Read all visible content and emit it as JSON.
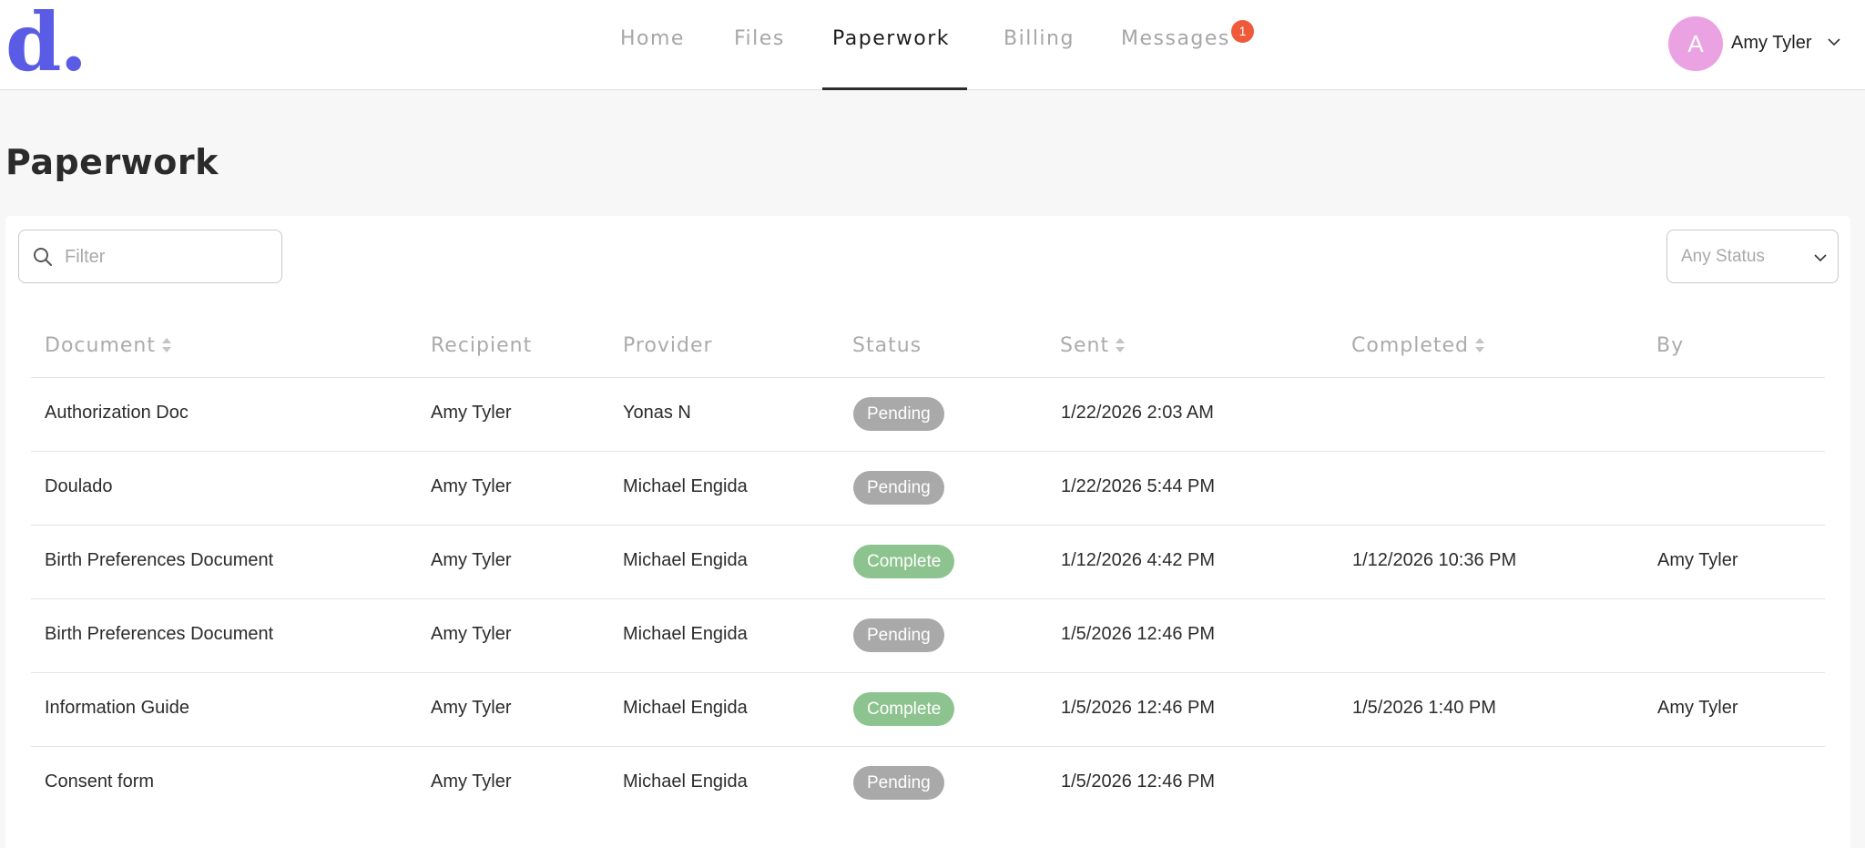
{
  "logo": {
    "text": "d."
  },
  "nav": {
    "items": [
      {
        "label": "Home"
      },
      {
        "label": "Files"
      },
      {
        "label": "Paperwork"
      },
      {
        "label": "Billing"
      },
      {
        "label": "Messages",
        "badge": "1"
      }
    ],
    "active": "Paperwork"
  },
  "user": {
    "initial": "A",
    "name": "Amy Tyler"
  },
  "page": {
    "title": "Paperwork"
  },
  "filter": {
    "placeholder": "Filter",
    "value": ""
  },
  "status_select": {
    "selected": "Any Status"
  },
  "table": {
    "headers": {
      "document": "Document",
      "recipient": "Recipient",
      "provider": "Provider",
      "status": "Status",
      "sent": "Sent",
      "completed": "Completed",
      "by": "By"
    },
    "rows": [
      {
        "document": "Authorization Doc",
        "recipient": "Amy Tyler",
        "provider": "Yonas N",
        "status": "Pending",
        "sent": "1/22/2026 2:03 AM",
        "completed": "",
        "by": ""
      },
      {
        "document": "Doulado",
        "recipient": "Amy Tyler",
        "provider": "Michael Engida",
        "status": "Pending",
        "sent": "1/22/2026 5:44 PM",
        "completed": "",
        "by": ""
      },
      {
        "document": "Birth Preferences Document",
        "recipient": "Amy Tyler",
        "provider": "Michael Engida",
        "status": "Complete",
        "sent": "1/12/2026 4:42 PM",
        "completed": "1/12/2026 10:36 PM",
        "by": "Amy Tyler"
      },
      {
        "document": "Birth Preferences Document",
        "recipient": "Amy Tyler",
        "provider": "Michael Engida",
        "status": "Pending",
        "sent": "1/5/2026 12:46 PM",
        "completed": "",
        "by": ""
      },
      {
        "document": "Information Guide",
        "recipient": "Amy Tyler",
        "provider": "Michael Engida",
        "status": "Complete",
        "sent": "1/5/2026 12:46 PM",
        "completed": "1/5/2026 1:40 PM",
        "by": "Amy Tyler"
      },
      {
        "document": "Consent form",
        "recipient": "Amy Tyler",
        "provider": "Michael Engida",
        "status": "Pending",
        "sent": "1/5/2026 12:46 PM",
        "completed": "",
        "by": ""
      }
    ]
  },
  "colors": {
    "brand": "#5a5ce6",
    "badge": "#ee5a3a",
    "avatar": "#eaa2e3",
    "pending": "#a9a9a9",
    "complete": "#8cc38e"
  }
}
